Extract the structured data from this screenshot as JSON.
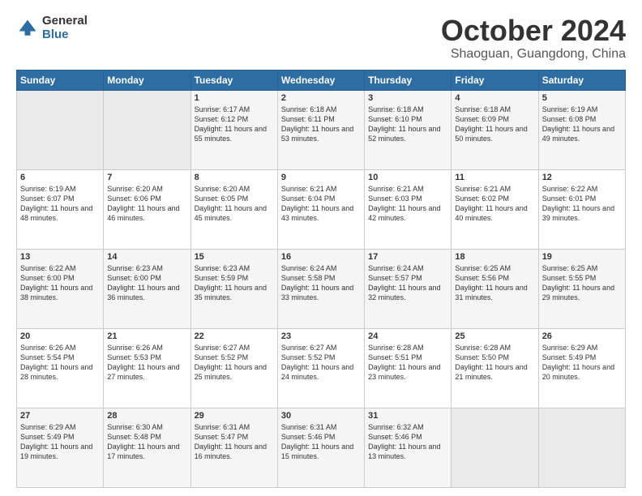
{
  "logo": {
    "general": "General",
    "blue": "Blue"
  },
  "title": {
    "month": "October 2024",
    "location": "Shaoguan, Guangdong, China"
  },
  "weekdays": [
    "Sunday",
    "Monday",
    "Tuesday",
    "Wednesday",
    "Thursday",
    "Friday",
    "Saturday"
  ],
  "weeks": [
    [
      {
        "day": "",
        "info": ""
      },
      {
        "day": "",
        "info": ""
      },
      {
        "day": "1",
        "info": "Sunrise: 6:17 AM\nSunset: 6:12 PM\nDaylight: 11 hours and 55 minutes."
      },
      {
        "day": "2",
        "info": "Sunrise: 6:18 AM\nSunset: 6:11 PM\nDaylight: 11 hours and 53 minutes."
      },
      {
        "day": "3",
        "info": "Sunrise: 6:18 AM\nSunset: 6:10 PM\nDaylight: 11 hours and 52 minutes."
      },
      {
        "day": "4",
        "info": "Sunrise: 6:18 AM\nSunset: 6:09 PM\nDaylight: 11 hours and 50 minutes."
      },
      {
        "day": "5",
        "info": "Sunrise: 6:19 AM\nSunset: 6:08 PM\nDaylight: 11 hours and 49 minutes."
      }
    ],
    [
      {
        "day": "6",
        "info": "Sunrise: 6:19 AM\nSunset: 6:07 PM\nDaylight: 11 hours and 48 minutes."
      },
      {
        "day": "7",
        "info": "Sunrise: 6:20 AM\nSunset: 6:06 PM\nDaylight: 11 hours and 46 minutes."
      },
      {
        "day": "8",
        "info": "Sunrise: 6:20 AM\nSunset: 6:05 PM\nDaylight: 11 hours and 45 minutes."
      },
      {
        "day": "9",
        "info": "Sunrise: 6:21 AM\nSunset: 6:04 PM\nDaylight: 11 hours and 43 minutes."
      },
      {
        "day": "10",
        "info": "Sunrise: 6:21 AM\nSunset: 6:03 PM\nDaylight: 11 hours and 42 minutes."
      },
      {
        "day": "11",
        "info": "Sunrise: 6:21 AM\nSunset: 6:02 PM\nDaylight: 11 hours and 40 minutes."
      },
      {
        "day": "12",
        "info": "Sunrise: 6:22 AM\nSunset: 6:01 PM\nDaylight: 11 hours and 39 minutes."
      }
    ],
    [
      {
        "day": "13",
        "info": "Sunrise: 6:22 AM\nSunset: 6:00 PM\nDaylight: 11 hours and 38 minutes."
      },
      {
        "day": "14",
        "info": "Sunrise: 6:23 AM\nSunset: 6:00 PM\nDaylight: 11 hours and 36 minutes."
      },
      {
        "day": "15",
        "info": "Sunrise: 6:23 AM\nSunset: 5:59 PM\nDaylight: 11 hours and 35 minutes."
      },
      {
        "day": "16",
        "info": "Sunrise: 6:24 AM\nSunset: 5:58 PM\nDaylight: 11 hours and 33 minutes."
      },
      {
        "day": "17",
        "info": "Sunrise: 6:24 AM\nSunset: 5:57 PM\nDaylight: 11 hours and 32 minutes."
      },
      {
        "day": "18",
        "info": "Sunrise: 6:25 AM\nSunset: 5:56 PM\nDaylight: 11 hours and 31 minutes."
      },
      {
        "day": "19",
        "info": "Sunrise: 6:25 AM\nSunset: 5:55 PM\nDaylight: 11 hours and 29 minutes."
      }
    ],
    [
      {
        "day": "20",
        "info": "Sunrise: 6:26 AM\nSunset: 5:54 PM\nDaylight: 11 hours and 28 minutes."
      },
      {
        "day": "21",
        "info": "Sunrise: 6:26 AM\nSunset: 5:53 PM\nDaylight: 11 hours and 27 minutes."
      },
      {
        "day": "22",
        "info": "Sunrise: 6:27 AM\nSunset: 5:52 PM\nDaylight: 11 hours and 25 minutes."
      },
      {
        "day": "23",
        "info": "Sunrise: 6:27 AM\nSunset: 5:52 PM\nDaylight: 11 hours and 24 minutes."
      },
      {
        "day": "24",
        "info": "Sunrise: 6:28 AM\nSunset: 5:51 PM\nDaylight: 11 hours and 23 minutes."
      },
      {
        "day": "25",
        "info": "Sunrise: 6:28 AM\nSunset: 5:50 PM\nDaylight: 11 hours and 21 minutes."
      },
      {
        "day": "26",
        "info": "Sunrise: 6:29 AM\nSunset: 5:49 PM\nDaylight: 11 hours and 20 minutes."
      }
    ],
    [
      {
        "day": "27",
        "info": "Sunrise: 6:29 AM\nSunset: 5:49 PM\nDaylight: 11 hours and 19 minutes."
      },
      {
        "day": "28",
        "info": "Sunrise: 6:30 AM\nSunset: 5:48 PM\nDaylight: 11 hours and 17 minutes."
      },
      {
        "day": "29",
        "info": "Sunrise: 6:31 AM\nSunset: 5:47 PM\nDaylight: 11 hours and 16 minutes."
      },
      {
        "day": "30",
        "info": "Sunrise: 6:31 AM\nSunset: 5:46 PM\nDaylight: 11 hours and 15 minutes."
      },
      {
        "day": "31",
        "info": "Sunrise: 6:32 AM\nSunset: 5:46 PM\nDaylight: 11 hours and 13 minutes."
      },
      {
        "day": "",
        "info": ""
      },
      {
        "day": "",
        "info": ""
      }
    ]
  ]
}
